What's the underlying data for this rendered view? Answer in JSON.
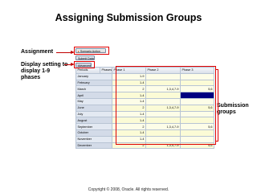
{
  "title": "Assigning Submission Groups",
  "labels": {
    "assignment": "Assignment",
    "display_setting": "Display setting to display 1-9 phases",
    "submission_groups": "Submission groups"
  },
  "footer": "Copyright © 2008, Oracle. All rights reserved.",
  "screenshot": {
    "toolbar": {
      "scenario_button": "Scenario Action",
      "submit_button": "Submit Data",
      "advanced_button": "Advanced"
    },
    "table": {
      "headers": [
        "Periods",
        "Phases",
        "Phase 1",
        "Phase 2",
        "Phase 3"
      ],
      "rows": [
        {
          "month": "January",
          "p1": "1-9",
          "p2": "",
          "p3": ""
        },
        {
          "month": "February",
          "p1": "1-4",
          "p2": "",
          "p3": ""
        },
        {
          "month": "March",
          "p1": "2",
          "p2": "1,3,4,7-9",
          "p3": "5,6"
        },
        {
          "month": "April",
          "p1": "1-4",
          "p2": "",
          "p3": ""
        },
        {
          "month": "May",
          "p1": "1-4",
          "p2": "",
          "p3": ""
        },
        {
          "month": "June",
          "p1": "2",
          "p2": "1,3,4,7-9",
          "p3": "5,6"
        },
        {
          "month": "July",
          "p1": "1-4",
          "p2": "",
          "p3": ""
        },
        {
          "month": "August",
          "p1": "1-4",
          "p2": "",
          "p3": ""
        },
        {
          "month": "September",
          "p1": "2",
          "p2": "1,3,4,7-9",
          "p3": "5,6"
        },
        {
          "month": "October",
          "p1": "1-4",
          "p2": "",
          "p3": ""
        },
        {
          "month": "November",
          "p1": "1-4",
          "p2": "",
          "p3": ""
        },
        {
          "month": "December",
          "p1": "2",
          "p2": "1,3,4,7-9",
          "p3": "5,6"
        }
      ]
    }
  },
  "colors": {
    "callout": "#e00000",
    "selected_cell": "#000080",
    "month_cell": "#e3e9f2",
    "phase_cell": "#fdfde8"
  }
}
